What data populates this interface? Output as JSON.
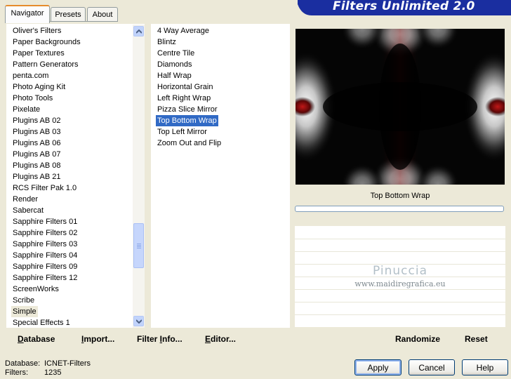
{
  "tabs": [
    {
      "label": "Navigator",
      "active": true
    },
    {
      "label": "Presets",
      "active": false
    },
    {
      "label": "About",
      "active": false
    }
  ],
  "banner": {
    "title": "Filters Unlimited 2.0",
    "color": "#1a2ea0"
  },
  "categories": {
    "items": [
      "Oliver's Filters",
      "Paper Backgrounds",
      "Paper Textures",
      "Pattern Generators",
      "penta.com",
      "Photo Aging Kit",
      "Photo Tools",
      "Pixelate",
      "Plugins AB 02",
      "Plugins AB 03",
      "Plugins AB 06",
      "Plugins AB 07",
      "Plugins AB 08",
      "Plugins AB 21",
      "RCS Filter Pak 1.0",
      "Render",
      "Sabercat",
      "Sapphire Filters 01",
      "Sapphire Filters 02",
      "Sapphire Filters 03",
      "Sapphire Filters 04",
      "Sapphire Filters 09",
      "Sapphire Filters 12",
      "ScreenWorks",
      "Scribe",
      "Simple",
      "Special Effects 1"
    ],
    "selected": "Simple"
  },
  "filters": {
    "items": [
      "4 Way Average",
      "Blintz",
      "Centre Tile",
      "Diamonds",
      "Half Wrap",
      "Horizontal Grain",
      "Left Right Wrap",
      "Pizza Slice Mirror",
      "Top Bottom Wrap",
      "Top Left Mirror",
      "Zoom Out and Flip"
    ],
    "selected": "Top Bottom Wrap"
  },
  "left_buttons": [
    {
      "label": "Database",
      "underline": "D",
      "rest": "atabase"
    },
    {
      "label": "Import...",
      "underline": "I",
      "rest": "mport..."
    },
    {
      "label": "Filter Info...",
      "pre": "Filter ",
      "underline": "I",
      "rest": "nfo..."
    },
    {
      "label": "Editor...",
      "underline": "E",
      "rest": "ditor..."
    }
  ],
  "preview": {
    "filter_name": "Top Bottom Wrap",
    "progress": 0
  },
  "right_buttons": {
    "randomize": "Randomize",
    "reset": "Reset"
  },
  "watermark": {
    "title": "Pinuccia",
    "url": "www.maidiregrafica.eu"
  },
  "status": {
    "database_label": "Database:",
    "database_value": "ICNET-Filters",
    "filters_label": "Filters:",
    "filters_value": "1235"
  },
  "footer": {
    "apply": "Apply",
    "cancel": "Cancel",
    "help": "Help"
  },
  "colors": {
    "selection": "#316ac5",
    "tab_accent": "#e68b2c",
    "window_bg": "#ece9d8"
  }
}
